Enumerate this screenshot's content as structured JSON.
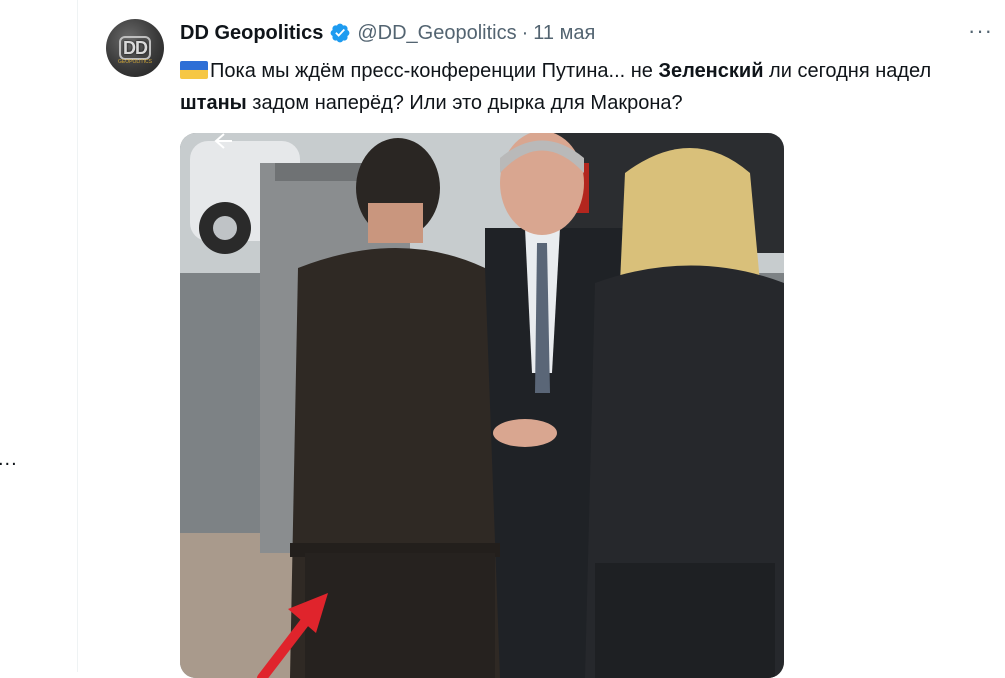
{
  "tweet": {
    "author_name": "DD Geopolitics",
    "handle": "@DD_Geopolitics",
    "separator": "·",
    "date": "11 мая",
    "avatar_text": "DD",
    "avatar_subtext": "GEOPOLITICS",
    "more_label": "···",
    "text": {
      "p1": "Пока мы ждём пресс-конференции Путина... не ",
      "b1": "Зеленский",
      "p2": " ли сегодня надел ",
      "b2": "штаны",
      "p3": " задом наперёд? Или это дырка для Макрона?"
    }
  },
  "sidebar": {
    "overflow_label": "..."
  },
  "icons": [
    "verified-badge-icon",
    "more-icon",
    "ukraine-flag-icon",
    "back-arrow-icon"
  ],
  "colors": {
    "accent": "#1d9bf0",
    "muted": "#536471",
    "arrow": "#e0242c"
  }
}
